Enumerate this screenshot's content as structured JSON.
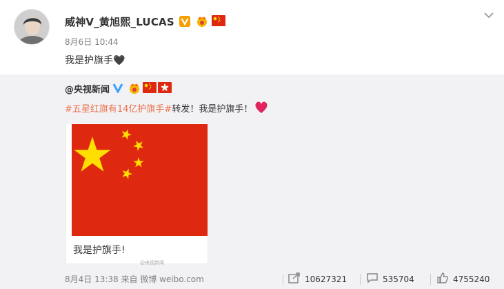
{
  "post": {
    "author": "威神V_黄旭熙_LUCAS",
    "time": "8月6日 10:44",
    "text": "我是护旗手🖤",
    "colors": {
      "topic_link": "#eb7350",
      "background_repost": "#f2f2f5"
    }
  },
  "repost": {
    "original_author": "@央视新闻",
    "topic": "#五星红旗有14亿护旗手#",
    "text": "转发！我是护旗手！",
    "media_caption": "我是护旗手!",
    "watermark": "@央视新闻"
  },
  "footer": {
    "meta": "8月4日 13:38 来自 微博 weibo.com",
    "share_count": "10627321",
    "comment_count": "535704",
    "like_count": "4755240"
  },
  "icons": [
    "chevron-down-icon",
    "verified-yellow-icon",
    "crown-icon",
    "china-flag-icon",
    "hongkong-flag-icon",
    "verified-blue-icon",
    "heart-icon",
    "share-icon",
    "comment-icon",
    "like-icon"
  ]
}
